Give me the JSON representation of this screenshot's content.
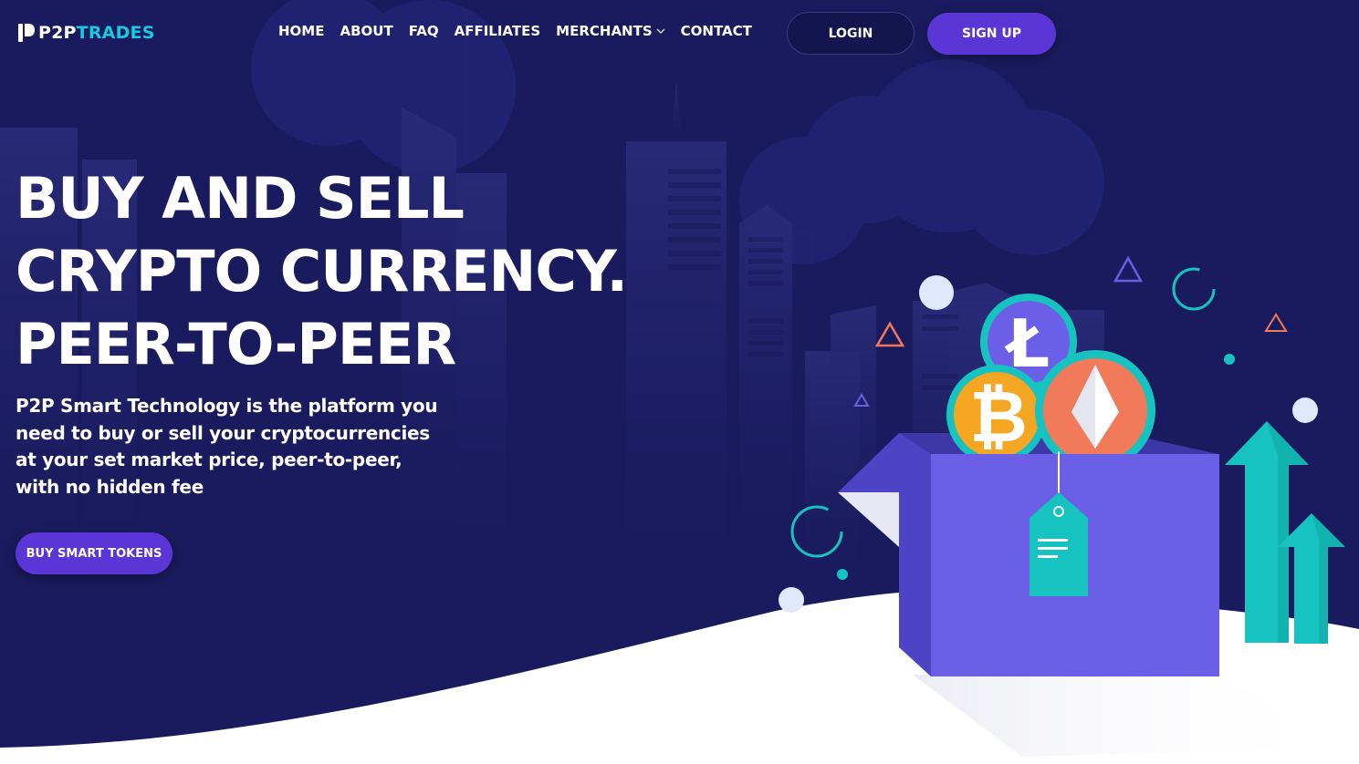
{
  "brand": {
    "name_part1": "P2P",
    "name_part2": "TRADES",
    "accent": "#19c9e0",
    "primary": "#5b36d6",
    "background": "#1a1b5e"
  },
  "nav": {
    "items": [
      {
        "label": "HOME"
      },
      {
        "label": "ABOUT"
      },
      {
        "label": "FAQ"
      },
      {
        "label": "AFFILIATES"
      },
      {
        "label": "MERCHANTS",
        "icon": "chevron-down-icon"
      },
      {
        "label": "CONTACT"
      }
    ],
    "login_label": "LOGIN",
    "signup_label": "SIGN UP"
  },
  "hero": {
    "title_lines": [
      "BUY AND SELL",
      "CRYPTO CURRENCY.",
      "PEER-TO-PEER"
    ],
    "description": "P2P Smart Technology is the platform you need to buy or sell your cryptocurrencies at your set market price, peer-to-peer, with no hidden fee",
    "cta_label": "BUY SMART TOKENS"
  },
  "illustration": {
    "coins": [
      "litecoin-icon",
      "bitcoin-icon",
      "ethereum-icon"
    ],
    "box_color": "#6a5fe6",
    "arrow_color": "#17c3c0"
  }
}
